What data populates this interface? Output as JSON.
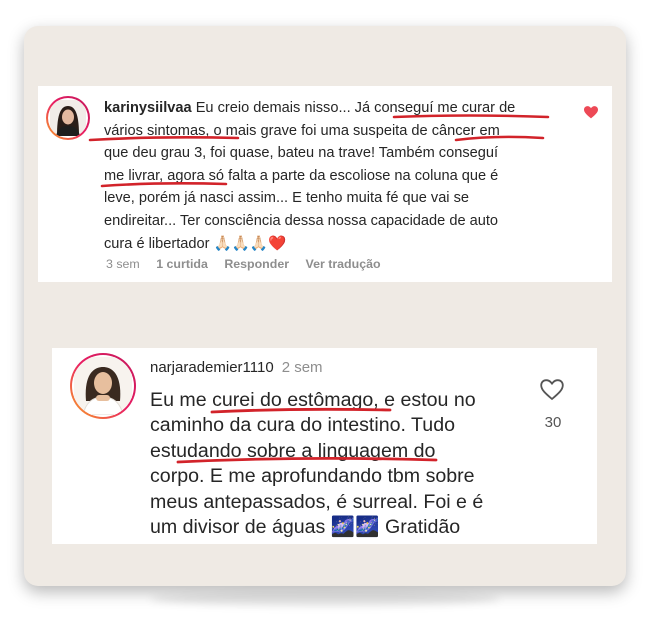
{
  "comment1": {
    "username": "karinysiilvaa",
    "lines": [
      "Eu creio demais nisso... Já conseguí me curar de",
      "vários sintomas, o mais grave foi uma suspeita de câncer em",
      "que deu grau 3, foi quase, bateu na trave! Também conseguí",
      "me livrar, agora só falta a parte da escoliose na coluna que é",
      "leve, porém já nasci assim... E tenho muita fé que vai se",
      "endireitar... Ter consciência dessa nossa capacidade de auto",
      "cura é libertador"
    ],
    "emojis": "🙏🏻🙏🏻🙏🏻❤️",
    "time": "3 sem",
    "likes": "1 curtida",
    "reply": "Responder",
    "translate": "Ver tradução",
    "liked_icon": "heart-filled-icon",
    "heart_color": "#ed4956"
  },
  "comment2": {
    "username": "narjarademier1110",
    "time": "2 sem",
    "lines": [
      "Eu me curei do estômago, e estou no",
      "caminho da cura do intestino. Tudo",
      "estudando sobre a linguagem do",
      "corpo. E me aprofundando tbm sobre",
      "meus antepassados, é surreal. Foi e é",
      "um divisor de águas"
    ],
    "emojis_and_suffix": "🌌🌌 Gratidão",
    "like_count": "30",
    "like_icon": "heart-outline-icon"
  },
  "highlight_color": "#d2232a"
}
